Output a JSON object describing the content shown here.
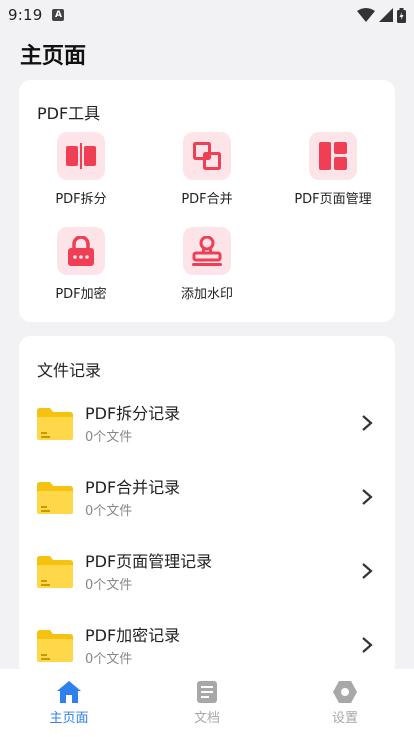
{
  "status_bar": {
    "time": "9:19",
    "app_icon_letter": "A",
    "icons": [
      "wifi-icon",
      "signal-icon",
      "battery-icon"
    ]
  },
  "page_title": "主页面",
  "tools": {
    "title": "PDF工具",
    "items": [
      {
        "label": "PDF拆分",
        "icon": "split-icon"
      },
      {
        "label": "PDF合并",
        "icon": "merge-icon"
      },
      {
        "label": "PDF页面管理",
        "icon": "page-manage-icon"
      },
      {
        "label": "PDF加密",
        "icon": "lock-icon"
      },
      {
        "label": "添加水印",
        "icon": "stamp-icon"
      }
    ]
  },
  "records": {
    "title": "文件记录",
    "items": [
      {
        "title": "PDF拆分记录",
        "count": "0个文件"
      },
      {
        "title": "PDF合并记录",
        "count": "0个文件"
      },
      {
        "title": "PDF页面管理记录",
        "count": "0个文件"
      },
      {
        "title": "PDF加密记录",
        "count": "0个文件"
      }
    ]
  },
  "nav": {
    "items": [
      {
        "label": "主页面",
        "icon": "home-icon",
        "active": true
      },
      {
        "label": "文档",
        "icon": "document-icon",
        "active": false
      },
      {
        "label": "设置",
        "icon": "settings-icon",
        "active": false
      }
    ]
  },
  "colors": {
    "accent": "#2f80ed",
    "tool_icon": "#f03e55",
    "tool_icon_bg": "#fde4e8",
    "folder": "#f5c20f",
    "inactive": "#a8a8a8"
  }
}
